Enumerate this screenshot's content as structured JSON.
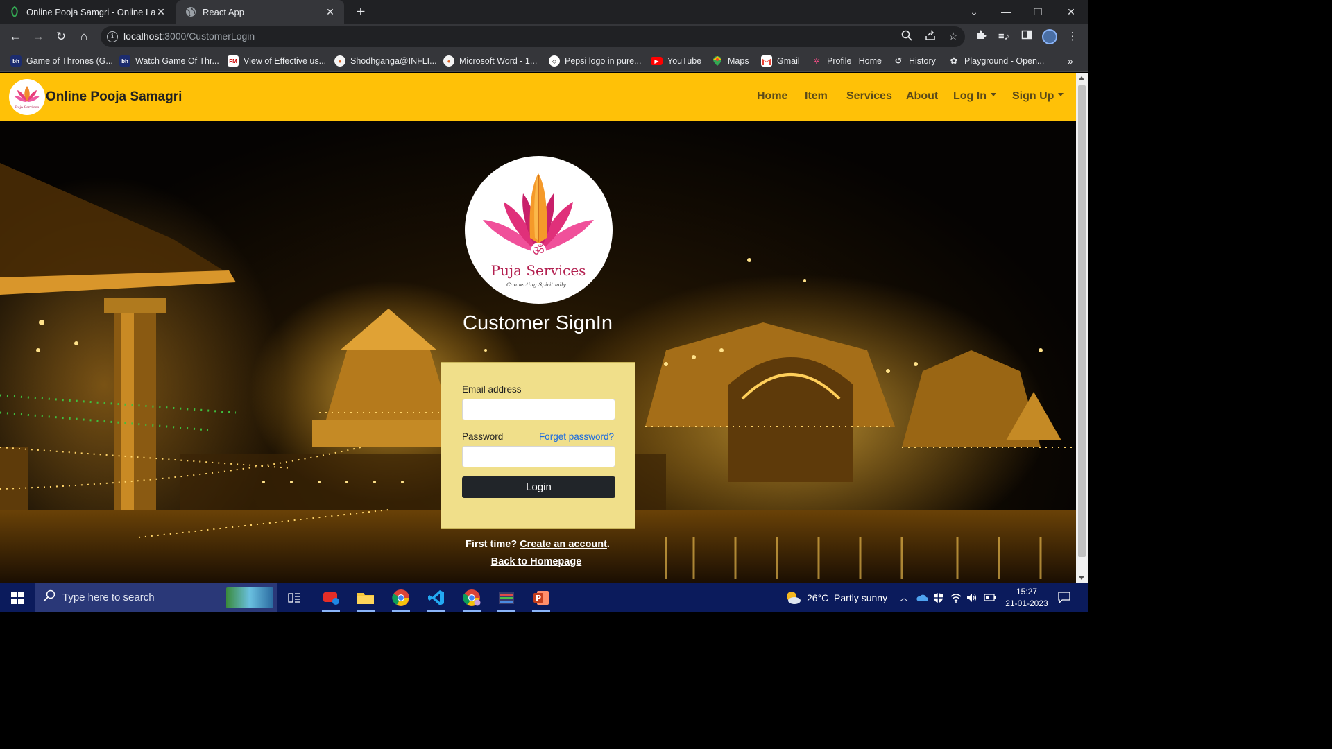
{
  "browser": {
    "tabs": [
      {
        "title": "Online Pooja Samgri - Online LaT",
        "active": false
      },
      {
        "title": "React App",
        "active": true
      }
    ],
    "url_host": "localhost",
    "url_path": ":3000/CustomerLogin",
    "bookmarks": [
      {
        "label": "Game of Thrones (G...",
        "icon": "bh-icon"
      },
      {
        "label": "Watch Game Of Thr...",
        "icon": "bh-icon"
      },
      {
        "label": "View of Effective us...",
        "icon": "fm-icon"
      },
      {
        "label": "Shodhganga@INFLI...",
        "icon": "inflibnet-icon"
      },
      {
        "label": "Microsoft Word - 1...",
        "icon": "inflibnet-icon"
      },
      {
        "label": "Pepsi logo in pure...",
        "icon": "codepen-icon"
      },
      {
        "label": "YouTube",
        "icon": "youtube-icon"
      },
      {
        "label": "Maps",
        "icon": "maps-icon"
      },
      {
        "label": "Gmail",
        "icon": "gmail-icon"
      },
      {
        "label": "Profile | Home",
        "icon": "profile-icon"
      },
      {
        "label": "History",
        "icon": "history-icon"
      },
      {
        "label": "Playground - Open...",
        "icon": "openai-icon"
      }
    ],
    "bookmarks_overflow": "»"
  },
  "navbar": {
    "brand": "Online Pooja Samagri",
    "links": [
      "Home",
      "Item",
      "Services",
      "About"
    ],
    "login_dropdown": "Log In",
    "signup_dropdown": "Sign Up",
    "brand_color": "#ffc107"
  },
  "hero": {
    "logo_text": "Puja Services",
    "logo_tagline": "Connecting Spiritually...",
    "title": "Customer SignIn"
  },
  "login_form": {
    "email_label": "Email address",
    "email_value": "",
    "password_label": "Password",
    "password_value": "",
    "forgot_link": "Forget password?",
    "submit_label": "Login",
    "card_color": "#f0df8a"
  },
  "footer_links": {
    "first_time": "First time?",
    "create_account": "Create an account",
    "create_suffix": ".",
    "back_home": "Back to Homepage"
  },
  "taskbar": {
    "search_placeholder": "Type here to search",
    "weather": "26°C  Partly sunny",
    "time": "15:27",
    "date": "21-01-2023"
  }
}
